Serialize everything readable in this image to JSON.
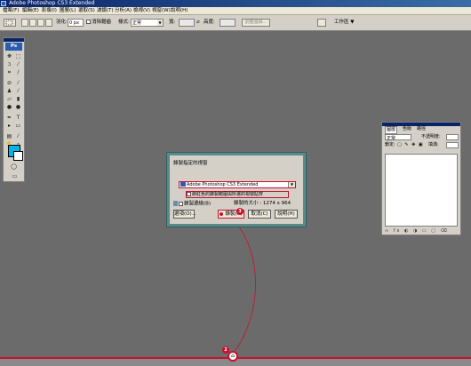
{
  "window": {
    "title": "Adobe Photoshop CS3 Extended"
  },
  "menu": [
    "檔案(F)",
    "編輯(E)",
    "影像(I)",
    "圖層(L)",
    "選取(S)",
    "濾鏡(T)",
    "分析(A)",
    "檢視(V)",
    "視窗(W)",
    "說明(H)"
  ],
  "options": {
    "feather_label": "羽化:",
    "feather_value": "0 px",
    "antialias_label": "消除鋸齒",
    "style_label": "樣式:",
    "style_value": "正常",
    "width_label": "寬:",
    "height_label": "高度:",
    "refine_edge": "調整邊緣...",
    "workspace": "工作區 ▼"
  },
  "tools": {
    "logo": "Ps"
  },
  "layers_panel": {
    "tabs": [
      "圖層",
      "色版",
      "路徑"
    ],
    "blend_mode": "正常",
    "opacity_label": "不透明度:",
    "lock_label": "鎖定:",
    "fill_label": "填滿:",
    "footer_icons": "∞ fx ◐ ◑ ▭ ▢ ⌫"
  },
  "dialog": {
    "title": "錄製指定的視窗",
    "app_selected": "Adobe Photoshop CS3 Extended",
    "red_check": "將紅色的錄製範圍與所選的視窗貼齊",
    "hide_label": "錄製邊緣(B)",
    "size_label": "錄製的大小 : 1274 x 964",
    "btn_options": "選項(O)...",
    "btn_record": "錄製(R)",
    "btn_cancel": "取消(C)",
    "btn_help": "說明(H)"
  },
  "badges": {
    "b2": "2",
    "b3": "3"
  },
  "colors": {
    "accent": "#c8102e",
    "foreground": "#00b4e6",
    "canvas": "#6b6b6b"
  }
}
